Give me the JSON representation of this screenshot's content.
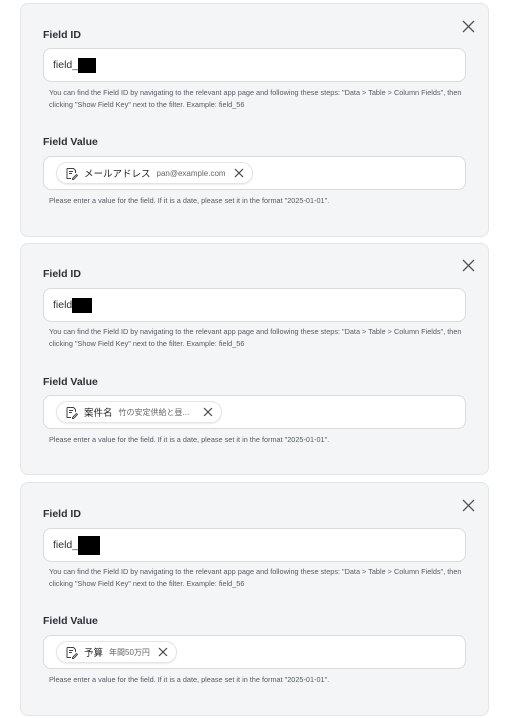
{
  "field_id_label": "Field ID",
  "field_value_label": "Field Value",
  "field_id_help": "You can find the Field ID by navigating to the relevant app page and following these steps: \"Data > Table > Column Fields\", then clicking \"Show Field Key\" next to the filter. Example: field_56",
  "field_value_help": "Please enter a value for the field. If it is a date, please set it in the format \"2025-01-01\".",
  "cards": [
    {
      "field_id_prefix": "field_",
      "chip_name": "メールアドレス",
      "chip_value": "pan@example.com"
    },
    {
      "field_id_prefix": "field",
      "chip_name": "案件名",
      "chip_value": "竹の安定供給と昼..."
    },
    {
      "field_id_prefix": "field_",
      "chip_name": "予算",
      "chip_value": "年間50万円"
    }
  ]
}
